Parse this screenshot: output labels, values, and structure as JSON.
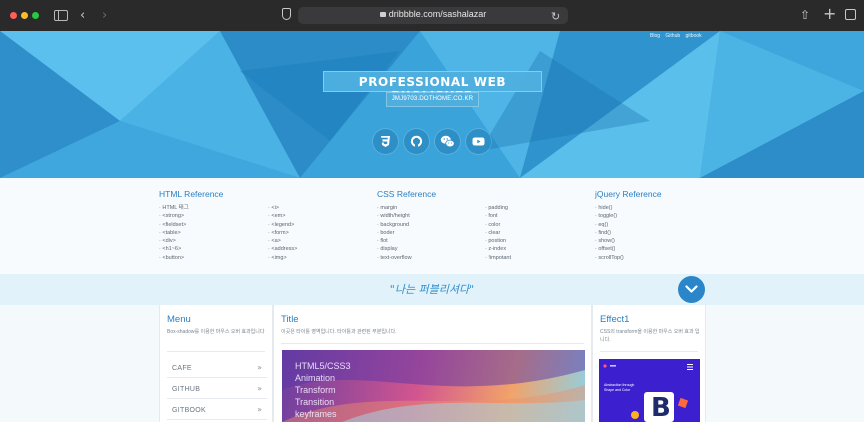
{
  "browser": {
    "url": "dribbble.com/sashalazar"
  },
  "hero": {
    "top_links": [
      "Blog",
      "Github",
      "gitbook"
    ],
    "title": "PROFESSIONAL WEB PUOLISHER",
    "subtitle": "JMJ9703.DOTHOME.CO.KR",
    "social_icons": [
      "css3-icon",
      "github-icon",
      "wechat-icon",
      "youtube-icon"
    ]
  },
  "reference": {
    "html": {
      "heading": "HTML Reference",
      "col1": [
        "HTML 태그",
        "<strong>",
        "<fieldset>",
        "<table>",
        "<div>",
        "<h1~6>",
        "<button>"
      ],
      "col2": [
        "<i>",
        "<em>",
        "<legend>",
        "<form>",
        "<a>",
        "<address>",
        "<img>"
      ]
    },
    "css": {
      "heading": "CSS Reference",
      "col1": [
        "margin",
        "width/height",
        "background",
        "boder",
        "flot",
        "display",
        "text-overflow"
      ],
      "col2": [
        "padding",
        "font",
        "color",
        "clear",
        "postion",
        "z-index",
        "!impotant"
      ]
    },
    "jquery": {
      "heading": "jQuery Reference",
      "col1": [
        "hide()",
        "toggle()",
        "eq()",
        "find()",
        "show()",
        "offset()",
        "scrollTop()"
      ]
    }
  },
  "band": {
    "script_text": "\"나는 퍼블리셔다\""
  },
  "menu_card": {
    "title": "Menu",
    "desc": "Box-shadow를 이용한 마우스 오버 효과입니다",
    "items": [
      {
        "label": "CAFE",
        "arrow": "»"
      },
      {
        "label": "GITHUB",
        "arrow": "»"
      },
      {
        "label": "GITBOOK",
        "arrow": "»"
      }
    ]
  },
  "title_card": {
    "title": "Title",
    "desc": "이곳은 타이틀 영역입니다. 타이틀과 관련된 부분입니다.",
    "image_lines": [
      "HTML5/CSS3",
      "Animation",
      "Transform",
      "Transition",
      "keyframes"
    ]
  },
  "effect_card": {
    "title": "Effect1",
    "desc": "CSS의 transform을 이용한 마우스 오버 효과 입니다.",
    "thumb_text": [
      "Abstraction through",
      "Shape and Color"
    ],
    "thumb_logo": "B"
  },
  "colors": {
    "accent": "#2b7fc4",
    "hero_blue": "#3b9fd4",
    "band": "#e1f2fa"
  }
}
